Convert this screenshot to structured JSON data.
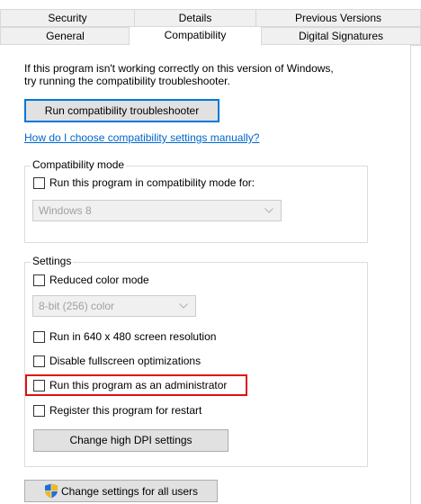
{
  "tabs": {
    "row1": [
      "Security",
      "Details",
      "Previous Versions"
    ],
    "row2": [
      "General",
      "Compatibility",
      "Digital Signatures"
    ]
  },
  "intro": {
    "line1": "If this program isn't working correctly on this version of Windows,",
    "line2": "try running the compatibility troubleshooter."
  },
  "buttons": {
    "troubleshooter": "Run compatibility troubleshooter",
    "dpi": "Change high DPI settings",
    "all_users": "Change settings for all users"
  },
  "link": "How do I choose compatibility settings manually?",
  "compat_mode": {
    "title": "Compatibility mode",
    "checkbox": "Run this program in compatibility mode for:",
    "checked": false,
    "select_value": "Windows 8"
  },
  "settings": {
    "title": "Settings",
    "reduced_color": "Reduced color mode",
    "color_select": "8-bit (256) color",
    "res640": "Run in 640 x 480 screen resolution",
    "fullscreen": "Disable fullscreen optimizations",
    "admin": "Run this program as an administrator",
    "restart": "Register this program for restart"
  },
  "colors": {
    "accent": "#0078d7",
    "link": "#0066cc",
    "highlight": "#e01010"
  }
}
